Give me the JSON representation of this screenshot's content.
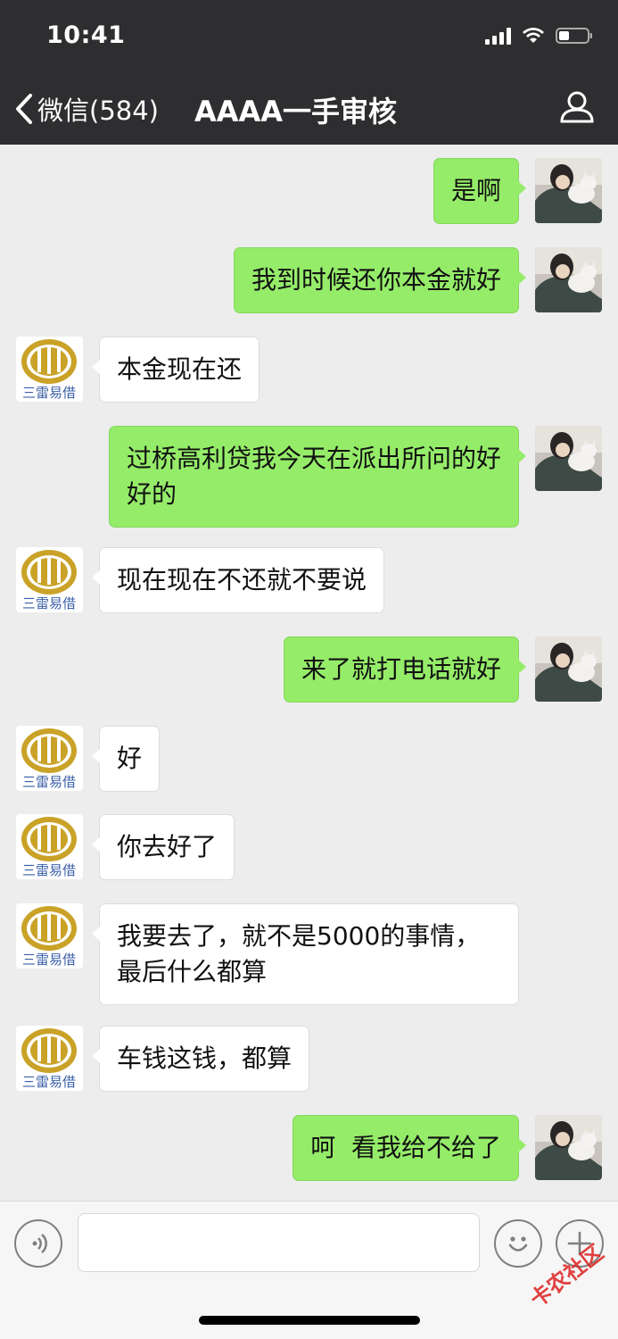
{
  "status_bar": {
    "time": "10:41"
  },
  "nav": {
    "back_label": "微信(584)",
    "title": "AAAA一手审核"
  },
  "contact_logo_text": "三雷易借",
  "messages": [
    {
      "side": "out",
      "text": "是啊"
    },
    {
      "side": "out",
      "text": "我到时候还你本金就好"
    },
    {
      "side": "in",
      "text": "本金现在还"
    },
    {
      "side": "out",
      "text": "过桥高利贷我今天在派出所问的好好的"
    },
    {
      "side": "in",
      "text": "现在现在不还就不要说"
    },
    {
      "side": "out",
      "text": "来了就打电话就好"
    },
    {
      "side": "in",
      "text": "好"
    },
    {
      "side": "in",
      "text": "你去好了"
    },
    {
      "side": "in",
      "text": "我要去了，就不是5000的事情，最后什么都算"
    },
    {
      "side": "in",
      "text": "车钱这钱，都算"
    },
    {
      "side": "out",
      "text": "呵  看我给不给了"
    }
  ],
  "input": {
    "placeholder": ""
  },
  "watermark": "卡农社区",
  "colors": {
    "header_bg": "#2e2e30",
    "chat_bg": "#ededed",
    "bubble_out": "#95ec69",
    "bubble_in": "#ffffff",
    "logo_gold": "#c9a227",
    "logo_blue": "#3a5fa8"
  },
  "icons": {
    "back": "chevron-left-icon",
    "user": "person-icon",
    "voice": "voice-icon",
    "emoji": "emoji-icon",
    "plus": "plus-icon"
  }
}
